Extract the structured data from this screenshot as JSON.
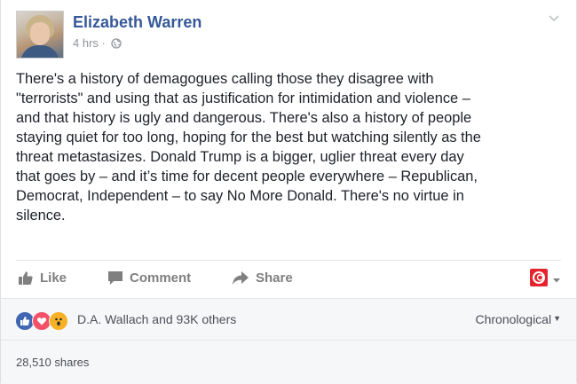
{
  "post": {
    "author": "Elizabeth Warren",
    "time": "4 hrs",
    "separator": "·",
    "text": "There's a history of demagogues calling those they disagree with\n\"terrorists\" and using that as justification for intimidation and violence –\nand that history is ugly and dangerous. There's also a history of people\nstaying quiet for too long, hoping for the best but watching silently as the\nthreat metastasizes. Donald Trump is a bigger, uglier threat every day\nthat goes by – and it’s time for decent people everywhere – Republican,\nDemocrat, Independent – to say No More Donald. There's no virtue in\nsilence."
  },
  "actions": {
    "like": "Like",
    "comment": "Comment",
    "share": "Share"
  },
  "reactions": {
    "summary": "D.A. Wallach and 93K others",
    "sort": "Chronological",
    "icons": [
      "like-icon",
      "love-icon",
      "wow-icon"
    ]
  },
  "shares": {
    "count": "28,510 shares"
  },
  "colors": {
    "author": "#365899",
    "text": "#1d2129",
    "muted": "#90949c",
    "like_blue": "#4267b2",
    "love_red": "#f25268",
    "wow_yellow": "#f7b125"
  }
}
